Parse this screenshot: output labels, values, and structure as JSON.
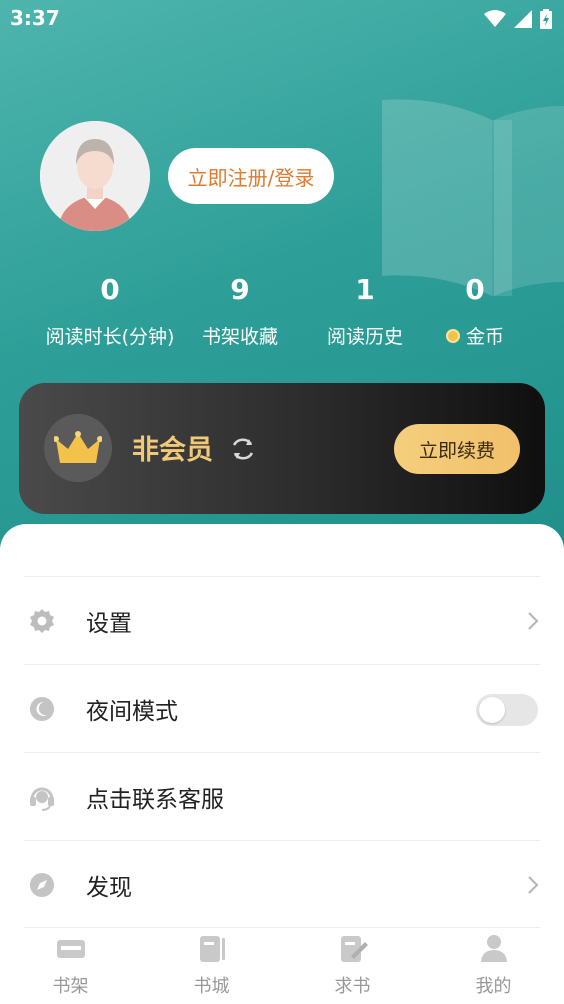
{
  "status_bar": {
    "time": "3:37"
  },
  "profile": {
    "login_label": "立即注册/登录"
  },
  "stats": [
    {
      "value": "0",
      "label": "阅读时长(分钟)"
    },
    {
      "value": "9",
      "label": "书架收藏"
    },
    {
      "value": "1",
      "label": "阅读历史"
    },
    {
      "value": "0",
      "label": "金币"
    }
  ],
  "vip": {
    "title": "非会员",
    "renew_label": "立即续费"
  },
  "menu": [
    {
      "label": "设置",
      "icon": "gear-icon"
    },
    {
      "label": "夜间模式",
      "icon": "moon-icon",
      "toggle_on": false
    },
    {
      "label": "点击联系客服",
      "icon": "headset-icon"
    },
    {
      "label": "发现",
      "icon": "compass-icon"
    }
  ],
  "tabs": [
    {
      "label": "书架",
      "icon": "bookshelf-icon"
    },
    {
      "label": "书城",
      "icon": "book-store-icon"
    },
    {
      "label": "求书",
      "icon": "request-book-icon"
    },
    {
      "label": "我的",
      "icon": "profile-icon",
      "active": true
    }
  ],
  "colors": {
    "teal": "#2e9f98",
    "accent_orange": "#e07a2e",
    "vip_gold": "#f2c976",
    "tab_gray": "#999999"
  }
}
